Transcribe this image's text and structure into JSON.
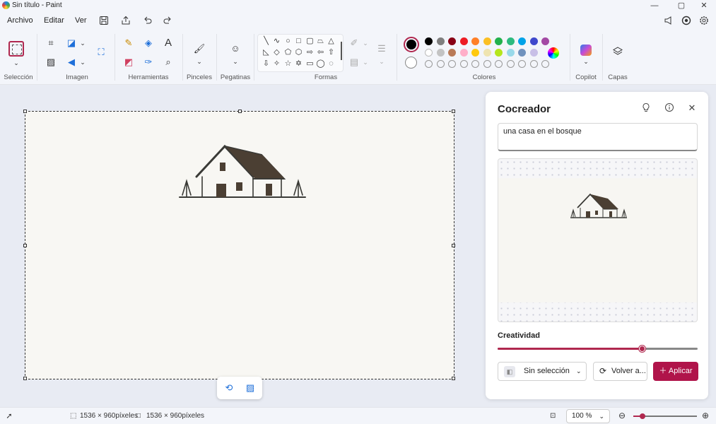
{
  "window": {
    "title": "Sin título - Paint",
    "minimize": "—",
    "maximize": "▢",
    "close": "✕"
  },
  "menu": {
    "items": [
      "Archivo",
      "Editar",
      "Ver"
    ]
  },
  "ribbon": {
    "groups": {
      "seleccion": "Selección",
      "imagen": "Imagen",
      "herramientas": "Herramientas",
      "pinceles": "Pinceles",
      "pegatinas": "Pegatinas",
      "formas": "Formas",
      "colores": "Colores",
      "copilot": "Copilot",
      "capas": "Capas"
    },
    "colors": {
      "primary": "#000000",
      "secondary": "#ffffff",
      "row1": [
        "#000000",
        "#7f7f7f",
        "#880015",
        "#ed1c24",
        "#ff7f27",
        "#fbbf24",
        "#22b14c",
        "#2dba7f",
        "#00a2e8",
        "#3f48cc",
        "#a349a4"
      ],
      "row2": [
        "#ffffff",
        "#c3c3c3",
        "#b97a57",
        "#ffaec9",
        "#ffc90e",
        "#efe4b0",
        "#b5e61d",
        "#99d9ea",
        "#7092be",
        "#c8bfe7"
      ]
    }
  },
  "cocreator": {
    "title": "Cocreador",
    "prompt": "una casa en el bosque",
    "creativity_label": "Creatividad",
    "creativity_level": 0.72,
    "style_button": "Sin selección",
    "retry_button": "Volver a...",
    "apply_button": "Aplicar"
  },
  "status": {
    "canvas_size": "1536 × 960píxeles",
    "image_size": "1536 × 960píxeles",
    "zoom": "100 %",
    "zoom_level": 0.14
  }
}
